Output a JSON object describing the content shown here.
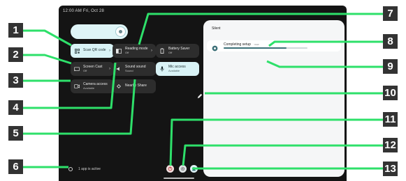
{
  "status_bar": {
    "time_date": "12:00 AM Fri, Oct 28"
  },
  "brightness": {
    "icon": "brightness-slider-knob"
  },
  "tiles": {
    "qr_scan": {
      "title": "Scan QR code",
      "icon": "qr-code-icon"
    },
    "screen_cast": {
      "title": "Screen Cast",
      "sub": "Off",
      "icon": "cast-icon"
    },
    "camera_access": {
      "title": "Camera access",
      "sub": "Available",
      "icon": "camera-icon"
    },
    "reading_mode": {
      "title": "Reading mode",
      "sub": "Off",
      "icon": "reading-mode-icon"
    },
    "sound_sound": {
      "title": "Sound sound",
      "sub": "Sound",
      "icon": "sound-icon"
    },
    "nearby_share": {
      "title": "Nearby Share",
      "icon": "nearby-share-icon"
    },
    "battery_saver": {
      "title": "Battery Saver",
      "sub": "Off",
      "icon": "battery-icon"
    },
    "mic_access": {
      "title": "Mic access",
      "sub": "Available",
      "icon": "mic-icon"
    }
  },
  "notifications": {
    "header": "Silent",
    "card": {
      "title": "Completing setup",
      "time": "· now",
      "progress_fraction": 0.75
    }
  },
  "apps_active": {
    "label": "1 app is active"
  },
  "callouts": [
    "1",
    "2",
    "3",
    "4",
    "5",
    "6",
    "7",
    "8",
    "9",
    "10",
    "11",
    "12",
    "13"
  ],
  "colors": {
    "accent": "#2ee06a",
    "tile_active": "#d9f3f6",
    "tile_dark": "#2d2d2d"
  }
}
